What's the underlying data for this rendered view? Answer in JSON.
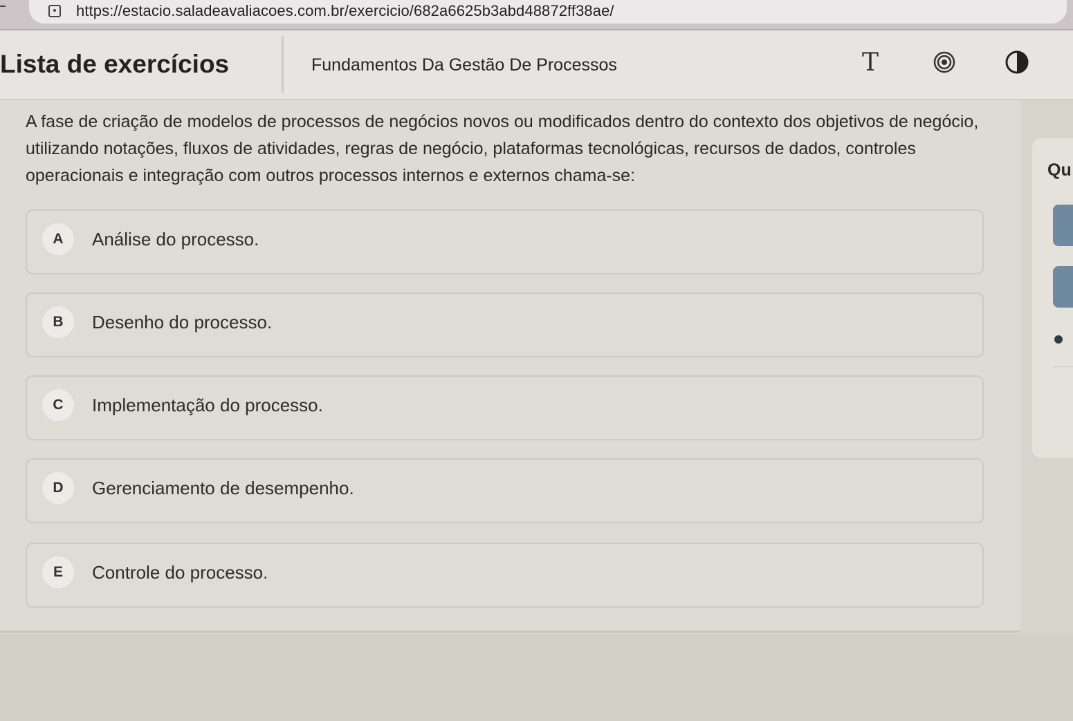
{
  "browser": {
    "url": "https://estacio.saladeavaliacoes.com.br/exercicio/682a6625b3abd48872ff38ae/"
  },
  "header": {
    "title": "Lista de exercícios",
    "course": "Fundamentos Da Gestão De Processos",
    "icons": [
      "text-size-icon",
      "target-icon",
      "contrast-icon"
    ]
  },
  "question": {
    "text": "A fase de criação de modelos de processos de negócios novos ou modificados dentro do contexto dos objetivos de negócio, utilizando notações, fluxos de atividades, regras de negócio, plataformas tecnológicas, recursos de dados, controles operacionais e integração com outros processos internos e externos chama-se:",
    "options": [
      {
        "letter": "A",
        "text": "Análise do processo."
      },
      {
        "letter": "B",
        "text": "Desenho do processo."
      },
      {
        "letter": "C",
        "text": "Implementação do processo."
      },
      {
        "letter": "D",
        "text": "Gerenciamento de desempenho."
      },
      {
        "letter": "E",
        "text": "Controle do processo."
      }
    ]
  },
  "side_panel": {
    "label": "Qu"
  },
  "colors": {
    "accent": "#6f8aa0",
    "background": "#dddbd4"
  }
}
